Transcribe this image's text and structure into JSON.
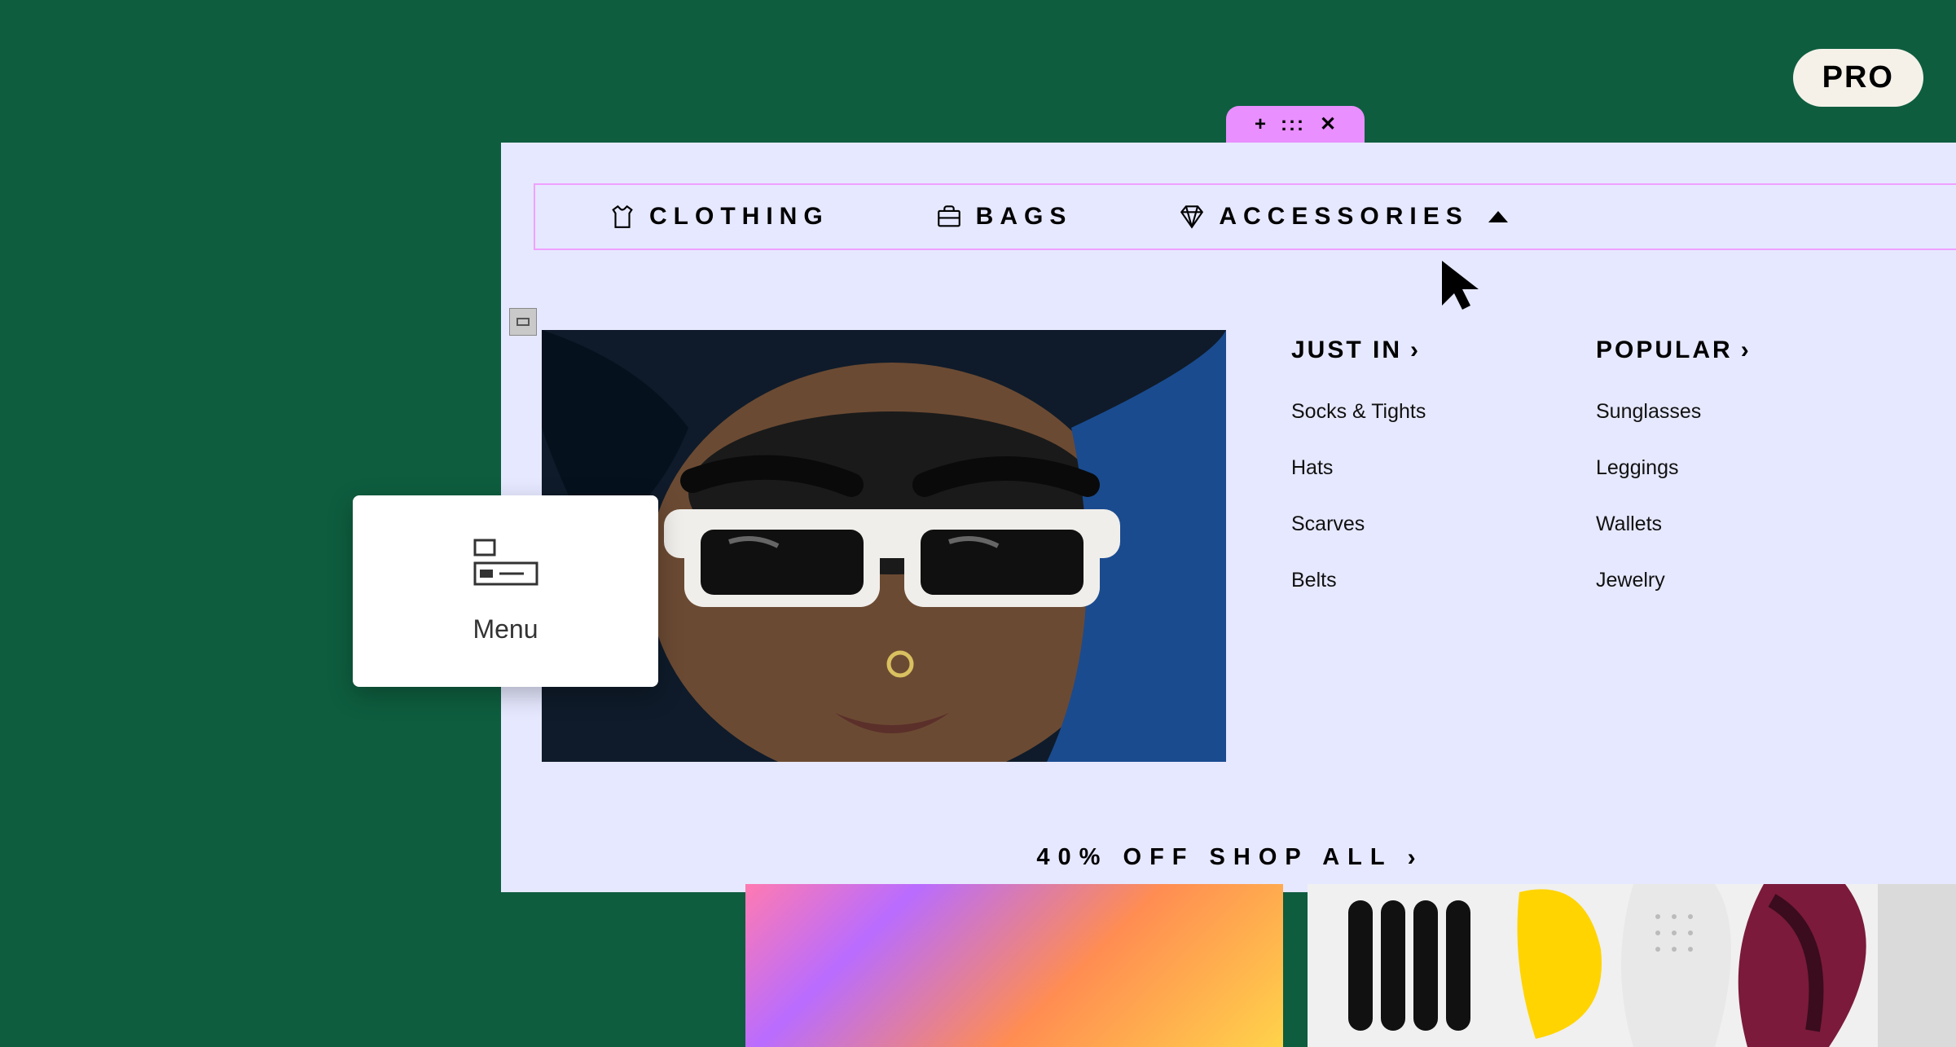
{
  "pro_badge": "PRO",
  "window_tab": {
    "add_label": "+",
    "drag_label": ":::",
    "close_label": "✕"
  },
  "nav": {
    "clothing": {
      "label": "CLOTHING",
      "icon": "tshirt-icon"
    },
    "bags": {
      "label": "BAGS",
      "icon": "briefcase-icon"
    },
    "accessories": {
      "label": "ACCESSORIES",
      "icon": "diamond-icon"
    }
  },
  "mega_menu": {
    "col1": {
      "heading": "JUST IN",
      "items": [
        "Socks & Tights",
        "Hats",
        "Scarves",
        "Belts"
      ]
    },
    "col2": {
      "heading": "POPULAR",
      "items": [
        "Sunglasses",
        "Leggings",
        "Wallets",
        "Jewelry"
      ]
    }
  },
  "promo": {
    "text": "40% OFF SHOP ALL"
  },
  "menu_card": {
    "label": "Menu"
  }
}
